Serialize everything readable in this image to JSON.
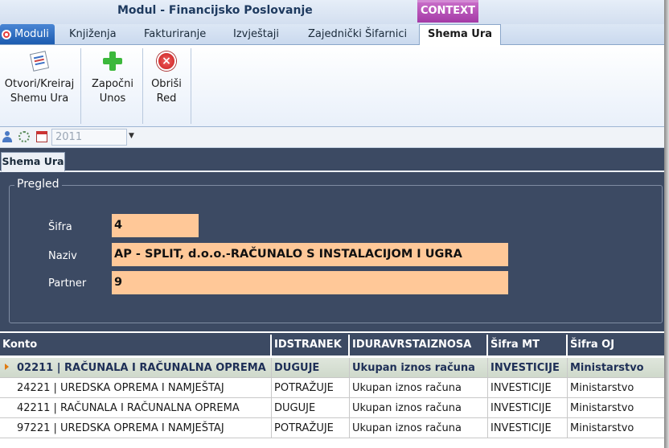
{
  "window": {
    "title": "Modul - Financijsko Poslovanje",
    "context_label": "CONTEXT"
  },
  "tabs": {
    "moduli": "Moduli",
    "items": [
      "Knjiženja",
      "Fakturiranje",
      "Izvještaji",
      "Zajednički Šifarnici"
    ],
    "active": "Shema Ura"
  },
  "ribbon": {
    "open_create": [
      "Otvori/Kreiraj",
      "Shemu Ura"
    ],
    "start_entry": [
      "Započni",
      "Unos"
    ],
    "delete_row": [
      "Obriši",
      "Red"
    ]
  },
  "toolbar": {
    "year": "2011"
  },
  "document": {
    "tab_label": "Shema Ura",
    "group_label": "Pregled",
    "fields": [
      {
        "label": "Šifra",
        "value": "4"
      },
      {
        "label": "Naziv",
        "value": "AP - SPLIT, d.o.o.-RAČUNALO S INSTALACIJOM I UGRA"
      },
      {
        "label": "Partner",
        "value": "9"
      }
    ]
  },
  "grid": {
    "columns": [
      "Konto",
      "IDSTRANEK",
      "IDURAVRSTAIZNOSA",
      "Šifra MT",
      "Šifra OJ"
    ],
    "rows": [
      [
        "02211 | RAČUNALA I RAČUNALNA OPREMA",
        "DUGUJE",
        "Ukupan iznos računa",
        "INVESTICIJE",
        "Ministarstvo"
      ],
      [
        "24221 | UREDSKA OPREMA I NAMJEŠTAJ",
        "POTRAŽUJE",
        "Ukupan iznos računa",
        "INVESTICIJE",
        "Ministarstvo"
      ],
      [
        "42211 | RAČUNALA I RAČUNALNA OPREMA",
        "DUGUJE",
        "Ukupan iznos računa",
        "INVESTICIJE",
        "Ministarstvo"
      ],
      [
        "97221 | UREDSKA OPREMA I NAMJEŠTAJ",
        "POTRAŽUJE",
        "Ukupan iznos računa",
        "INVESTICIJE",
        "Ministarstvo"
      ]
    ]
  }
}
